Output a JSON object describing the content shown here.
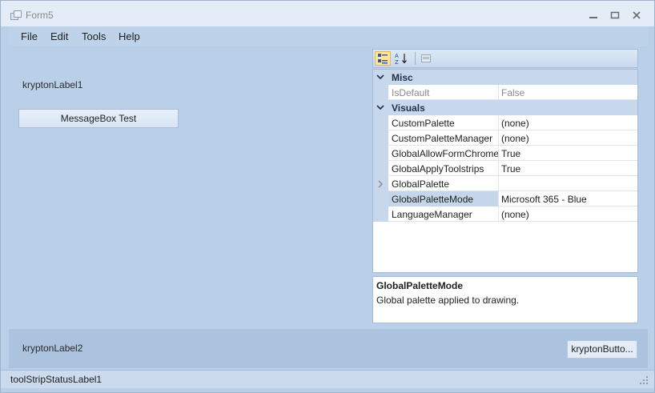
{
  "window": {
    "title": "Form5"
  },
  "menu": {
    "items": [
      "File",
      "Edit",
      "Tools",
      "Help"
    ]
  },
  "client": {
    "label1": "kryptonLabel1",
    "button": "MessageBox Test"
  },
  "property_grid": {
    "toolbar": {
      "categorized_icon": "categorized-icon",
      "alphabetical_icon": "sort-az-icon",
      "pages_icon": "property-pages-icon"
    },
    "categories": [
      {
        "name": "Misc",
        "properties": [
          {
            "name": "IsDefault",
            "value": "False"
          }
        ]
      },
      {
        "name": "Visuals",
        "properties": [
          {
            "name": "CustomPalette",
            "value": "(none)"
          },
          {
            "name": "CustomPaletteManager",
            "value": "(none)"
          },
          {
            "name": "GlobalAllowFormChrome",
            "value": "True"
          },
          {
            "name": "GlobalApplyToolstrips",
            "value": "True"
          },
          {
            "name": "GlobalPalette",
            "value": ""
          },
          {
            "name": "GlobalPaletteMode",
            "value": "Microsoft 365 - Blue"
          },
          {
            "name": "LanguageManager",
            "value": "(none)"
          }
        ]
      }
    ],
    "help": {
      "title": "GlobalPaletteMode",
      "description": "Global palette applied to drawing."
    }
  },
  "bottom": {
    "label2": "kryptonLabel2",
    "button": "kryptonButto..."
  },
  "statusbar": {
    "label": "toolStripStatusLabel1"
  },
  "colors": {
    "accent": "#ffe5a0",
    "category_bg": "#c8d8ec",
    "form_bg": "#bad0e8"
  }
}
